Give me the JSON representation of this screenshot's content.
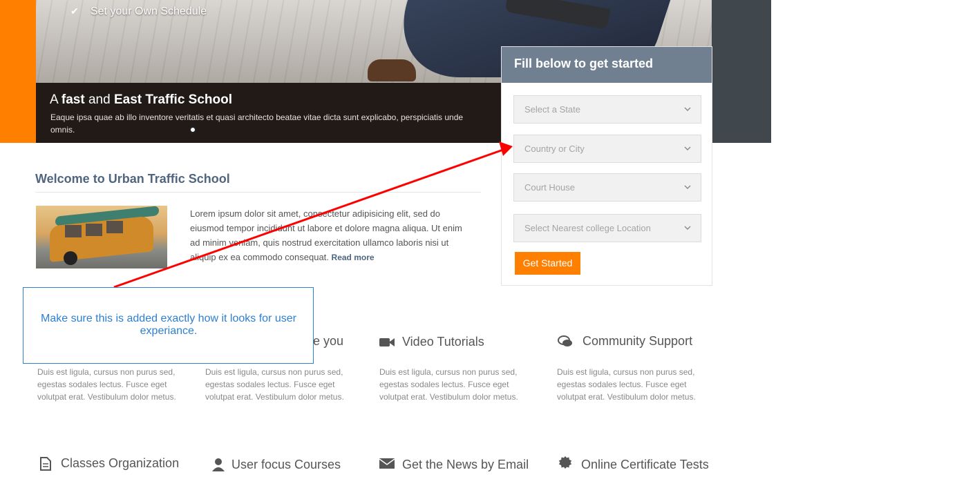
{
  "hero": {
    "check_text": "Set your Own Schedule",
    "title_parts": {
      "a": "A ",
      "fast": "fast",
      "and": " and ",
      "east": "East Traffic School"
    },
    "description": "Eaque ipsa quae ab illo inventore veritatis et quasi architecto beatae vitae dicta sunt explicabo, perspiciatis unde omnis."
  },
  "form": {
    "title": "Fill below to get started",
    "selects": [
      {
        "placeholder": "Select a State"
      },
      {
        "placeholder": "Country or City"
      },
      {
        "placeholder": "Court House"
      },
      {
        "placeholder": "Select Nearest college Location"
      }
    ],
    "button_label": "Get Started"
  },
  "welcome": {
    "title": "Welcome to Urban Traffic School",
    "body": "Lorem ipsum dolor sit amet, consectetur adipisicing elit, sed do eiusmod tempor incididunt ut labore et dolore magna aliqua. Ut enim ad minim veniam, quis nostrud exercitation ullamco laboris nisi ut aliquip ex ea commodo consequat.",
    "read_more": "Read more"
  },
  "features": [
    {
      "title": "e you",
      "icon": "partial-icon",
      "desc": "Duis est ligula, cursus non purus sed, egestas sodales lectus. Fusce eget volutpat erat. Vestibulum dolor metus."
    },
    {
      "title": "Video Tutorials",
      "icon": "video-camera-icon",
      "desc": "Duis est ligula, cursus non purus sed, egestas sodales lectus. Fusce eget volutpat erat. Vestibulum dolor metus."
    },
    {
      "title": "Community Support",
      "icon": "chat-bubbles-icon",
      "desc": "Duis est ligula, cursus non purus sed, egestas sodales lectus. Fusce eget volutpat erat. Vestibulum dolor metus."
    },
    {
      "title": "Duis est ligula, cursus non purus sed, egestas sodales lectus. Fusce eget volutpat erat. Vestibulum dolor metus.",
      "icon": "none",
      "desc": ""
    }
  ],
  "features_row2": [
    {
      "title": "Classes Organization",
      "icon": "document-icon"
    },
    {
      "title": "User focus Courses",
      "icon": "user-icon"
    },
    {
      "title": "Get the News by Email",
      "icon": "envelope-icon"
    },
    {
      "title": "Online Certificate Tests",
      "icon": "gear-badge-icon"
    }
  ],
  "annotation": {
    "text": "Make sure this is added exactly how it looks for user experiance."
  },
  "colors": {
    "orange": "#ff7f00",
    "slate": "#718090",
    "annotation_blue": "#2d7fd1",
    "arrow_red": "#ff0000"
  }
}
